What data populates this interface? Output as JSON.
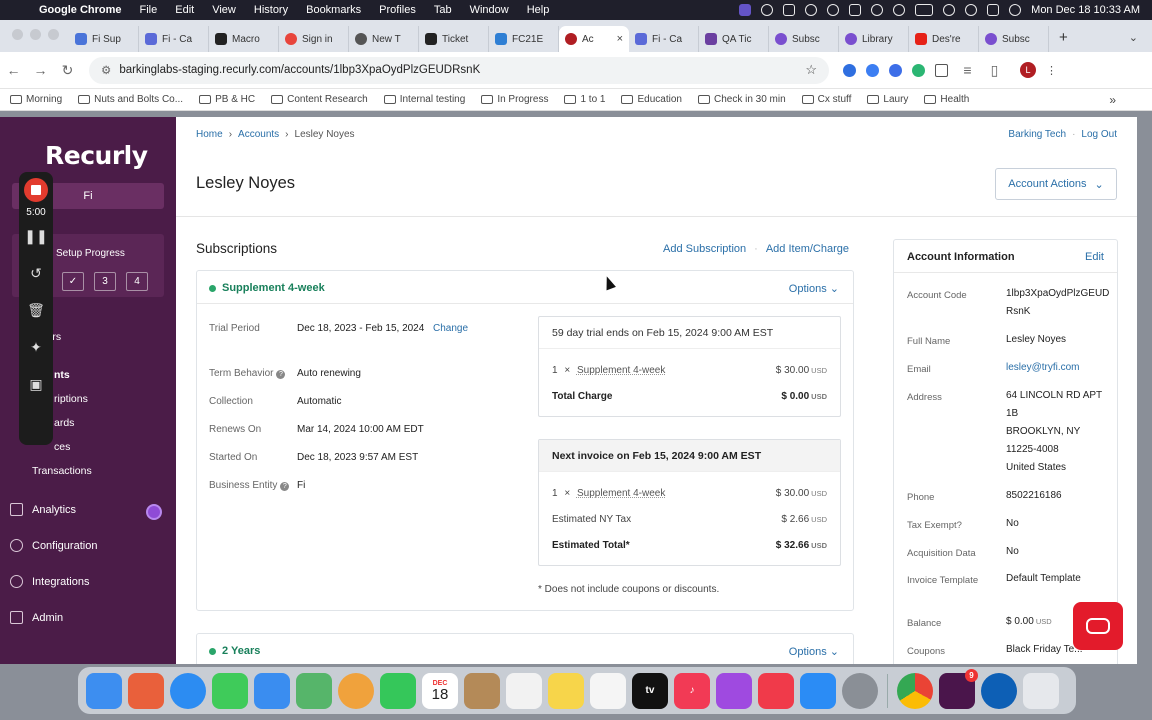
{
  "menubar": {
    "app": "Google Chrome",
    "items": [
      "File",
      "Edit",
      "View",
      "History",
      "Bookmarks",
      "Profiles",
      "Tab",
      "Window",
      "Help"
    ],
    "datetime": "Mon Dec 18  10:33 AM"
  },
  "tabs": [
    {
      "label": "Fi Sup",
      "color": "#4a74d9"
    },
    {
      "label": "Fi - Ca",
      "color": "#5b6ad8"
    },
    {
      "label": "Macro",
      "color": "#222222"
    },
    {
      "label": "Sign in",
      "color": "#e8453c"
    },
    {
      "label": "New T",
      "color": "#555555"
    },
    {
      "label": "Ticket",
      "color": "#222222"
    },
    {
      "label": "FC21E",
      "color": "#2f7fd4"
    },
    {
      "label": "Ac",
      "color": "#b01e23"
    },
    {
      "label": "Fi - Ca",
      "color": "#5b6ad8"
    },
    {
      "label": "QA Tic",
      "color": "#6b3fa0"
    },
    {
      "label": "Subsc",
      "color": "#7a4fcf"
    },
    {
      "label": "Library",
      "color": "#7a4fcf"
    },
    {
      "label": "Des're",
      "color": "#e62117"
    },
    {
      "label": "Subsc",
      "color": "#7a4fcf"
    }
  ],
  "browser": {
    "url": "barkinglabs-staging.recurly.com/accounts/1lbp3XpaOydPlzGEUDRsnK",
    "profile_initial": "L"
  },
  "bookmarks": [
    "Morning",
    "Nuts and Bolts Co...",
    "PB & HC",
    "Content Research",
    "Internal testing",
    "In Progress",
    "1 to 1",
    "Education",
    "Check in 30 min",
    "Cx stuff",
    "Laury",
    "Health"
  ],
  "sidebar": {
    "logo": "Recurly",
    "site": "Fi",
    "setup_label": "Setup Progress",
    "steps": [
      "✓",
      "3",
      "4"
    ],
    "partial_items": [
      "omers",
      "nts",
      "riptions",
      "ards",
      "ces"
    ],
    "transactions": "Transactions",
    "main_items": [
      {
        "label": "Analytics",
        "icon": "analytics-icon"
      },
      {
        "label": "Configuration",
        "icon": "gear-icon"
      },
      {
        "label": "Integrations",
        "icon": "integrations-icon"
      },
      {
        "label": "Admin",
        "icon": "admin-icon"
      }
    ]
  },
  "recorder": {
    "time": "5:00"
  },
  "breadcrumb": {
    "home": "Home",
    "accounts": "Accounts",
    "current": "Lesley Noyes"
  },
  "topright": {
    "company": "Barking Tech",
    "logout": "Log Out"
  },
  "account": {
    "name": "Lesley Noyes",
    "actions_label": "Account Actions"
  },
  "subscriptions": {
    "title": "Subscriptions",
    "add_subscription": "Add Subscription",
    "add_item": "Add Item/Charge",
    "options_label": "Options",
    "first": {
      "plan": "Supplement 4-week",
      "trial_period_label": "Trial Period",
      "trial_period": "Dec 18, 2023 - Feb 15, 2024",
      "change": "Change",
      "term_behavior_label": "Term Behavior",
      "term_behavior": "Auto renewing",
      "collection_label": "Collection",
      "collection": "Automatic",
      "renews_label": "Renews On",
      "renews": "Mar 14, 2024 10:00 AM EDT",
      "started_label": "Started On",
      "started": "Dec 18, 2023 9:57 AM EST",
      "entity_label": "Business Entity",
      "entity": "Fi",
      "trial_box": {
        "header": "59 day trial ends on Feb 15, 2024 9:00 AM EST",
        "qty": "1",
        "times": "×",
        "item": "Supplement 4-week",
        "currency": "$",
        "item_amount": "30.00",
        "unit": "USD",
        "total_label": "Total Charge",
        "total_amount": "0.00"
      },
      "next_box": {
        "header": "Next invoice on Feb 15, 2024 9:00 AM EST",
        "qty": "1",
        "times": "×",
        "item": "Supplement 4-week",
        "currency": "$",
        "item_amount": "30.00",
        "unit": "USD",
        "tax_label": "Estimated NY Tax",
        "tax_amount": "2.66",
        "total_label": "Estimated Total*",
        "total_amount": "32.66"
      },
      "footnote": "* Does not include coupons or discounts."
    },
    "second": {
      "plan": "2 Years"
    }
  },
  "account_info": {
    "title": "Account Information",
    "edit": "Edit",
    "code_label": "Account Code",
    "code": "1lbp3XpaOydPlzGEUDRsnK",
    "name_label": "Full Name",
    "name": "Lesley Noyes",
    "email_label": "Email",
    "email": "lesley@tryfi.com",
    "address_label": "Address",
    "address_lines": [
      "64 LINCOLN RD APT 1B",
      "BROOKLYN, NY 11225-4008",
      "United States"
    ],
    "phone_label": "Phone",
    "phone": "8502216186",
    "tax_label": "Tax Exempt?",
    "tax": "No",
    "acq_label": "Acquisition Data",
    "acq": "No",
    "template_label": "Invoice Template",
    "template": "Default Template",
    "balance_label": "Balance",
    "balance_currency": "$",
    "balance": "0.00",
    "balance_unit": "USD",
    "coupons_label": "Coupons",
    "coupons": "Black Friday Te..."
  },
  "dock": {
    "apps": [
      {
        "name": "finder-icon",
        "color": "#3d8ef0"
      },
      {
        "name": "launchpad-icon",
        "color": "#e9603b"
      },
      {
        "name": "safari-icon",
        "color": "#2c8cf2"
      },
      {
        "name": "messages-icon",
        "color": "#3fcb5a"
      },
      {
        "name": "mail-icon",
        "color": "#3a8df0"
      },
      {
        "name": "maps-icon",
        "color": "#56b56a"
      },
      {
        "name": "photos-icon",
        "color": "#f0a23c"
      },
      {
        "name": "facetime-icon",
        "color": "#35c75a"
      },
      {
        "name": "calendar-icon",
        "color": "#ffffff"
      },
      {
        "name": "contacts-icon",
        "color": "#b48a58"
      },
      {
        "name": "reminders-icon",
        "color": "#f2f2f2"
      },
      {
        "name": "notes-icon",
        "color": "#f7d54a"
      },
      {
        "name": "freeform-icon",
        "color": "#f5f5f5"
      },
      {
        "name": "appletv-icon",
        "color": "#111111"
      },
      {
        "name": "music-icon",
        "color": "#f23a55"
      },
      {
        "name": "podcasts-icon",
        "color": "#9f4ae0"
      },
      {
        "name": "news-icon",
        "color": "#f03a4a"
      },
      {
        "name": "appstore-icon",
        "color": "#2b8cf5"
      },
      {
        "name": "settings-icon",
        "color": "#8a8f96"
      }
    ],
    "calendar_month": "DEC",
    "calendar_day": "18",
    "tv_label": "tv",
    "slack_badge": "9"
  }
}
